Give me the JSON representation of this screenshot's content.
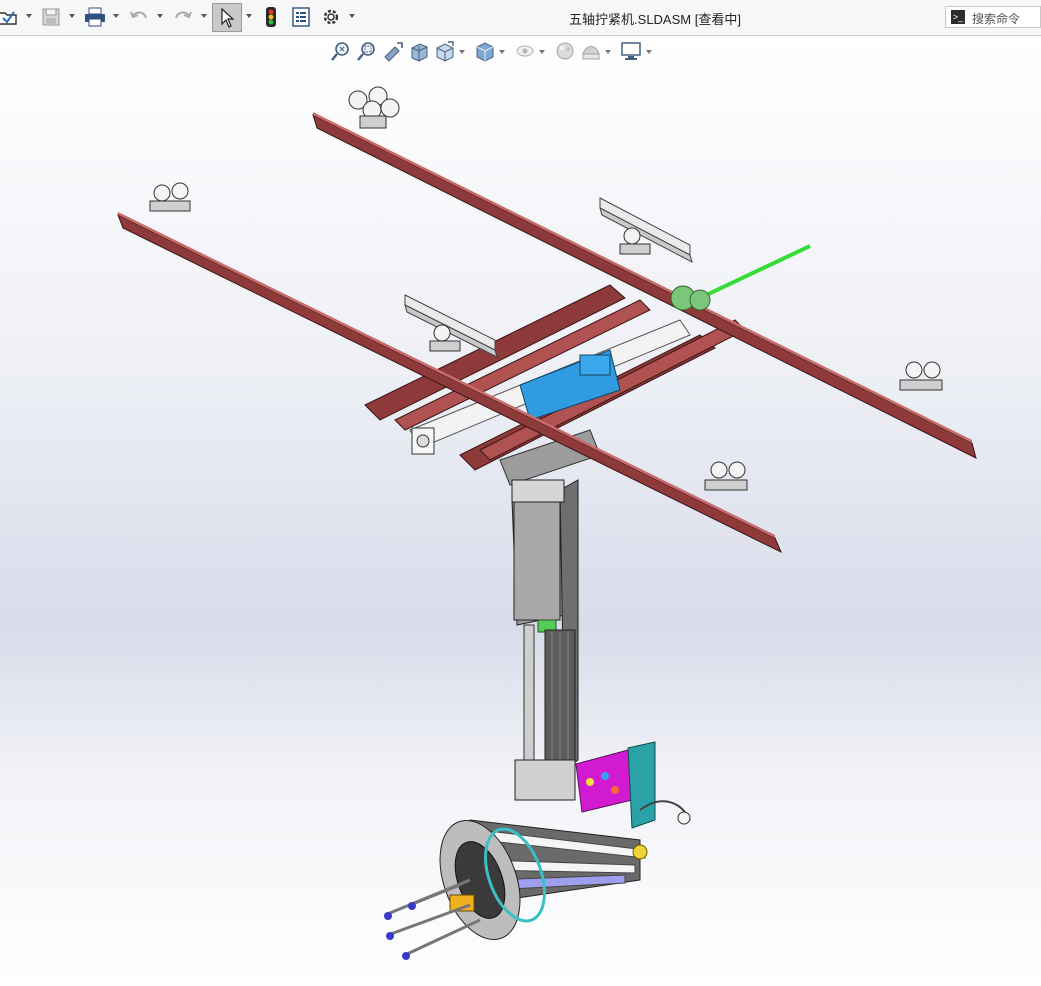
{
  "window": {
    "title": "五轴拧紧机.SLDASM [查看中]"
  },
  "toolbar": {
    "items": [
      {
        "name": "open",
        "icon": "open-icon"
      },
      {
        "name": "save",
        "icon": "save-icon"
      },
      {
        "name": "print",
        "icon": "print-icon"
      },
      {
        "name": "undo",
        "icon": "undo-icon"
      },
      {
        "name": "redo",
        "icon": "redo-icon"
      },
      {
        "name": "select",
        "icon": "select-arrow-icon"
      },
      {
        "name": "rebuild",
        "icon": "traffic-light-icon"
      },
      {
        "name": "file-properties",
        "icon": "file-properties-icon"
      },
      {
        "name": "options",
        "icon": "gear-icon"
      }
    ]
  },
  "search": {
    "placeholder": "搜索命令"
  },
  "heads_up_toolbar": {
    "items": [
      "zoom-to-fit-icon",
      "zoom-to-area-icon",
      "previous-view-icon",
      "section-view-icon",
      "view-orientation-icon",
      "display-style-icon",
      "hide-show-items-icon",
      "edit-appearance-icon",
      "apply-scene-icon",
      "view-settings-icon"
    ]
  },
  "colors": {
    "beam": "#8e3a3a",
    "beam_light": "#b05252",
    "cylinder_blue": "#2f9be0",
    "accent_green": "#33dd33",
    "block_magenta": "#d21ad2",
    "block_teal": "#2aa3a8",
    "viewport_gradient": "#d8dcea"
  }
}
